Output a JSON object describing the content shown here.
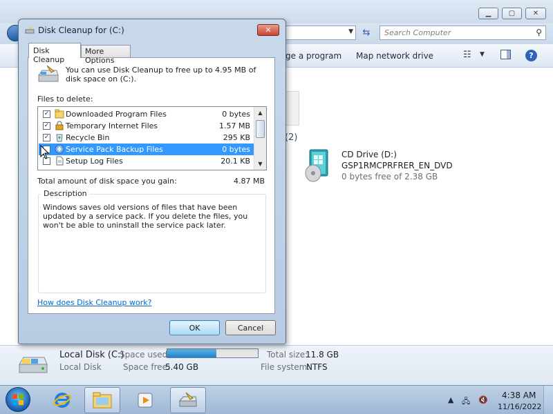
{
  "explorer": {
    "search_placeholder": "Search Computer",
    "toolbar": {
      "uninstall_partial": "ge a program",
      "map_network_drive": "Map network drive"
    },
    "group_count_partial": "(2)",
    "cd_drive": {
      "name": "CD Drive (D:)",
      "label": "GSP1RMCPRFRER_EN_DVD",
      "free": "0 bytes free of 2.38 GB"
    },
    "details": {
      "drive_name": "Local Disk (C:)",
      "drive_type": "Local Disk",
      "space_used_label": "Space used:",
      "space_used_fraction": 0.54,
      "space_free_label": "Space free:",
      "space_free_value": "5.40 GB",
      "total_size_label": "Total size:",
      "total_size_value": "11.8 GB",
      "file_system_label": "File system:",
      "file_system_value": "NTFS"
    }
  },
  "dialog": {
    "title": "Disk Cleanup for  (C:)",
    "close_label": "✕",
    "tabs": [
      "Disk Cleanup",
      "More Options"
    ],
    "intro": "You can use Disk Cleanup to free up to 4.95 MB of disk space on  (C:).",
    "files_label": "Files to delete:",
    "files": [
      {
        "checked": true,
        "name": "Downloaded Program Files",
        "size": "0 bytes",
        "icon": "folder-icon"
      },
      {
        "checked": true,
        "name": "Temporary Internet Files",
        "size": "1.57 MB",
        "icon": "lock-icon"
      },
      {
        "checked": true,
        "name": "Recycle Bin",
        "size": "295 KB",
        "icon": "recycle-bin-icon"
      },
      {
        "checked": false,
        "name": "Service Pack Backup Files",
        "size": "0 bytes",
        "icon": "service-pack-icon",
        "selected": true
      },
      {
        "checked": false,
        "name": "Setup Log Files",
        "size": "20.1 KB",
        "icon": "document-icon"
      }
    ],
    "total_label": "Total amount of disk space you gain:",
    "total_value": "4.87 MB",
    "description_legend": "Description",
    "description": "Windows saves old versions of files that have been updated by a service pack. If you delete the files, you won't be able to uninstall the service pack later.",
    "help_link": "How does Disk Cleanup work?",
    "ok_label": "OK",
    "cancel_label": "Cancel"
  },
  "taskbar": {
    "time": "4:38 AM",
    "date": "11/16/2022"
  }
}
